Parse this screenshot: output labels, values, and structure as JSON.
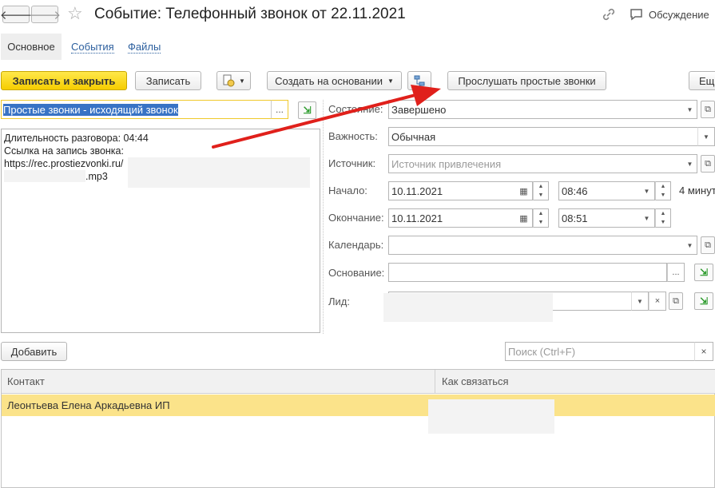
{
  "title": "Событие: Телефонный звонок от 22.11.2021",
  "header_link": "Обсуждение",
  "tabs": [
    {
      "label": "Основное"
    },
    {
      "label": "События"
    },
    {
      "label": "Файлы"
    }
  ],
  "toolbar": {
    "save_close": "Записать и закрыть",
    "save": "Записать",
    "create_based": "Создать на основании",
    "listen": "Прослушать простые звонки",
    "more_cut": "Ещ"
  },
  "subject": "Простые звонки - исходящий звонок",
  "description_lines": [
    "Длительность разговора: 04:44",
    "Ссылка на запись звонка:",
    "https://rec.prostiezvonki.ru/",
    ".mp3"
  ],
  "form": {
    "state_label": "Состояние:",
    "state_value": "Завершено",
    "importance_label": "Важность:",
    "importance_value": "Обычная",
    "source_label": "Источник:",
    "source_placeholder": "Источник привлечения",
    "start_label": "Начало:",
    "start_date": "10.11.2021",
    "start_time": "08:46",
    "duration": "4 минут",
    "end_label": "Окончание:",
    "end_date": "10.11.2021",
    "end_time": "08:51",
    "calendar_label": "Календарь:",
    "basis_label": "Основание:",
    "lead_label": "Лид:"
  },
  "contacts": {
    "add_button": "Добавить",
    "search_placeholder": "Поиск (Ctrl+F)",
    "columns": [
      "Контакт",
      "Как связаться"
    ],
    "rows": [
      {
        "contact": "Леонтьева Елена Аркадьевна ИП",
        "how": ""
      }
    ]
  },
  "colors": {
    "primary_button": "#f6cd00",
    "selected_row": "#fbe38a",
    "arrow": "#e0201b"
  }
}
